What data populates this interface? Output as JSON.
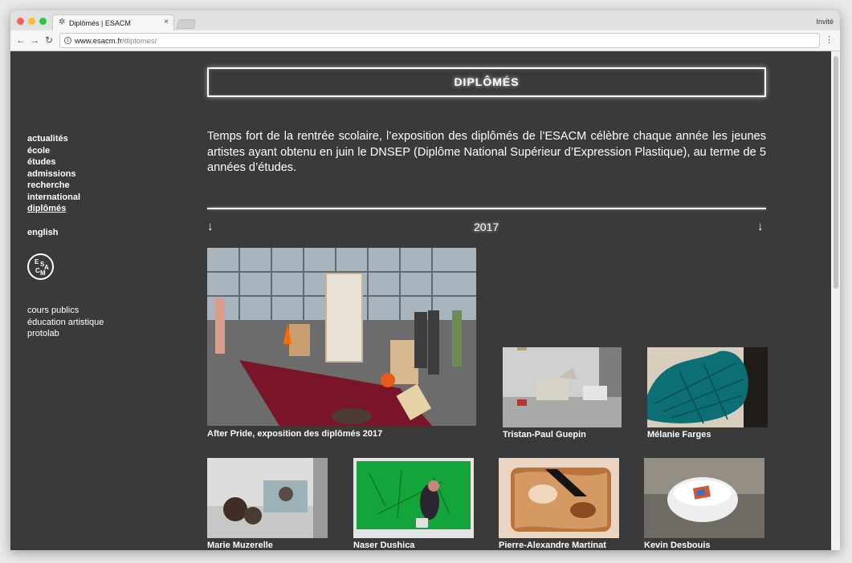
{
  "browser": {
    "tab_title": "Diplômés | ESACM",
    "tab_close": "×",
    "profile_label": "Invité",
    "url_host": "www.esacm.fr",
    "url_path": "/diplomes/",
    "back_icon": "←",
    "forward_icon": "→",
    "reload_icon": "↻",
    "menu_icon": "⋮",
    "info_icon": "i"
  },
  "sidebar": {
    "main_links": [
      "actualités",
      "école",
      "études",
      "admissions",
      "recherche",
      "international",
      "diplômés"
    ],
    "active_link": "diplômés",
    "language_link": "english",
    "logo_letters": [
      "E",
      "S",
      "A",
      "C",
      "M"
    ],
    "secondary_links": [
      "cours publics",
      "éducation artistique",
      "protolab"
    ]
  },
  "page": {
    "title": "DIPLÔMÉS",
    "intro": "Temps fort de la rentrée scolaire, l’exposition des diplômés de l’ESACM célèbre chaque année les jeunes artistes ayant obtenu en juin le DNSEP (Diplôme National Supérieur d’Expression Plastique), au terme de 5 années d’études.",
    "year": "2017",
    "arrow_left": "↓",
    "arrow_right": "↓"
  },
  "gallery": {
    "featured": "After Pride, exposition des diplômés 2017",
    "row1": [
      "Tristan-Paul Guepin",
      "Mélanie Farges"
    ],
    "row2": [
      "Marie Muzerelle",
      "Naser Dushica",
      "Pierre-Alexandre Martinat",
      "Kevin Desbouis"
    ]
  }
}
